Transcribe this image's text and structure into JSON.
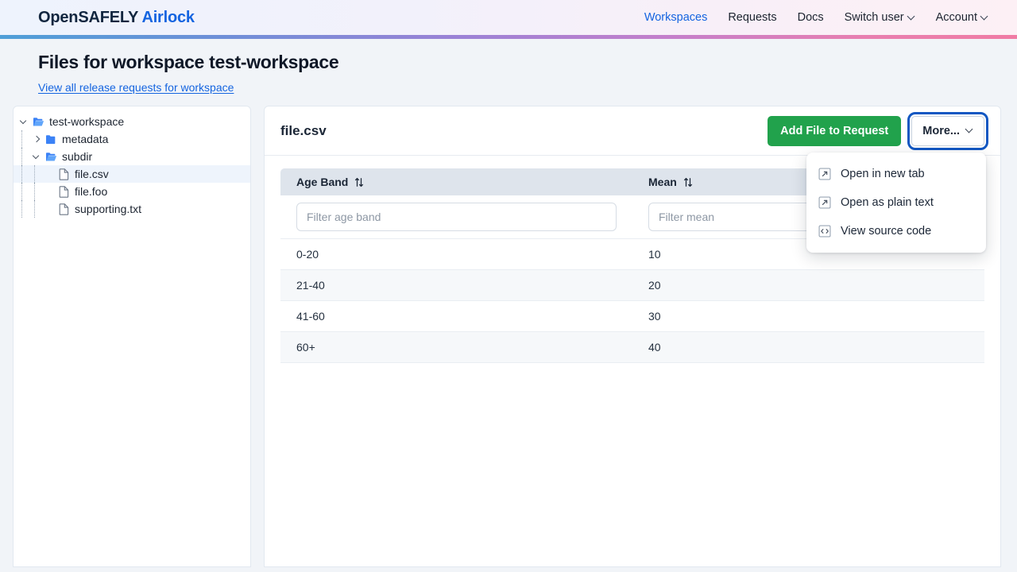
{
  "header": {
    "brand_main": "OpenSAFELY",
    "brand_accent": "Airlock",
    "nav": [
      {
        "label": "Workspaces",
        "active": true,
        "has_caret": false,
        "name": "nav-workspaces"
      },
      {
        "label": "Requests",
        "active": false,
        "has_caret": false,
        "name": "nav-requests"
      },
      {
        "label": "Docs",
        "active": false,
        "has_caret": false,
        "name": "nav-docs"
      },
      {
        "label": "Switch user",
        "active": false,
        "has_caret": true,
        "name": "nav-switch-user"
      },
      {
        "label": "Account",
        "active": false,
        "has_caret": true,
        "name": "nav-account"
      }
    ]
  },
  "page": {
    "title": "Files for workspace test-workspace",
    "link_label": "View all release requests for workspace"
  },
  "tree": {
    "items": [
      {
        "label": "test-workspace",
        "depth": 0,
        "type": "folder-open",
        "icon": "folder-open-icon",
        "expanded": true,
        "selected": false
      },
      {
        "label": "metadata",
        "depth": 1,
        "type": "folder-closed",
        "icon": "folder-closed-icon",
        "expanded": false,
        "selected": false
      },
      {
        "label": "subdir",
        "depth": 1,
        "type": "folder-open",
        "icon": "folder-open-icon",
        "expanded": true,
        "selected": false
      },
      {
        "label": "file.csv",
        "depth": 2,
        "type": "file",
        "icon": "file-icon",
        "expanded": null,
        "selected": true
      },
      {
        "label": "file.foo",
        "depth": 2,
        "type": "file",
        "icon": "file-icon",
        "expanded": null,
        "selected": false
      },
      {
        "label": "supporting.txt",
        "depth": 2,
        "type": "file",
        "icon": "file-icon",
        "expanded": null,
        "selected": false
      }
    ]
  },
  "content": {
    "file_name": "file.csv",
    "add_button_label": "Add File to Request",
    "more_button_label": "More...",
    "menu": {
      "open": true,
      "items": [
        {
          "label": "Open in new tab",
          "icon": "external-link-icon",
          "name": "menu-item-open-new-tab"
        },
        {
          "label": "Open as plain text",
          "icon": "external-link-icon",
          "name": "menu-item-open-plain-text"
        },
        {
          "label": "View source code",
          "icon": "code-icon",
          "name": "menu-item-view-source"
        }
      ]
    }
  },
  "table": {
    "columns": [
      {
        "header": "Age Band",
        "filter_placeholder": "Filter age band",
        "filter_value": "",
        "sort_icon": "sort-icon"
      },
      {
        "header": "Mean",
        "filter_placeholder": "Filter mean",
        "filter_value": "",
        "sort_icon": "sort-icon"
      }
    ],
    "rows": [
      [
        "0-20",
        "10"
      ],
      [
        "21-40",
        "20"
      ],
      [
        "41-60",
        "30"
      ],
      [
        "60+",
        "40"
      ]
    ]
  },
  "colors": {
    "brand_accent": "#1464e0",
    "primary_button": "#21a24c",
    "focus_ring": "#1257c2",
    "table_header": "#dee4ec",
    "selected_row": "#eef4fc"
  }
}
